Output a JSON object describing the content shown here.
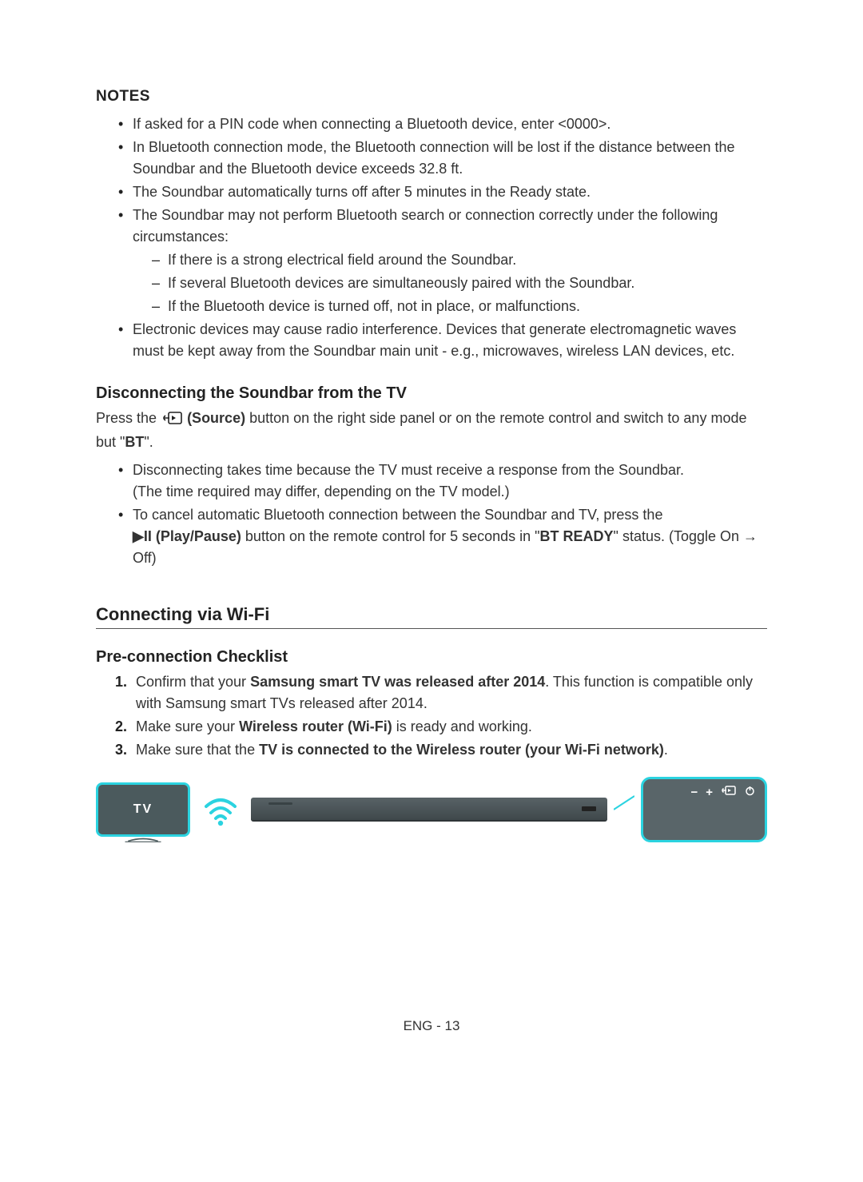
{
  "notes": {
    "heading": "NOTES",
    "items": [
      "If asked for a PIN code when connecting a Bluetooth device, enter <0000>.",
      "In Bluetooth connection mode, the Bluetooth connection will be lost if the distance between the Soundbar and the Bluetooth device exceeds 32.8 ft.",
      "The Soundbar automatically turns off after 5 minutes in the Ready state.",
      "The Soundbar may not perform Bluetooth search or connection correctly under the following circumstances:",
      "Electronic devices may cause radio interference. Devices that generate electromagnetic waves must be kept away from the Soundbar main unit - e.g., microwaves, wireless LAN devices, etc."
    ],
    "sub_items": [
      "If there is a strong electrical field around the Soundbar.",
      "If several Bluetooth devices are simultaneously paired with the Soundbar.",
      "If the Bluetooth device is turned off, not in place, or malfunctions."
    ]
  },
  "disconnect": {
    "heading": "Disconnecting the Soundbar from the TV",
    "para_prefix": "Press the ",
    "source_label": " (Source)",
    "para_mid": " button on the right side panel or on the remote control and switch to any mode but \"",
    "bt_label": "BT",
    "para_suffix": "\".",
    "bullets": {
      "b1_line1": "Disconnecting takes time because the TV must receive a response from the Soundbar.",
      "b1_line2": "(The time required may differ, depending on the TV model.)",
      "b2_line1": "To cancel automatic Bluetooth connection between the Soundbar and TV, press the ",
      "b2_play": "▶II (Play/Pause)",
      "b2_mid": " button on the remote control for 5 seconds in \"",
      "b2_btready": "BT READY",
      "b2_suffix": "\" status. (Toggle On → Off)"
    }
  },
  "wifi": {
    "heading": "Connecting via Wi-Fi",
    "checklist_heading": "Pre-connection Checklist",
    "items": {
      "i1_prefix": "Confirm that your ",
      "i1_bold": "Samsung smart TV was released after 2014",
      "i1_suffix": ". This function is compatible only with Samsung smart TVs released after 2014.",
      "i2_prefix": "Make sure your ",
      "i2_bold": "Wireless router (Wi-Fi)",
      "i2_suffix": " is ready and working.",
      "i3_prefix": "Make sure that the ",
      "i3_bold": "TV is connected to the Wireless router (your Wi-Fi network)",
      "i3_suffix": "."
    }
  },
  "diagram": {
    "tv_label": "TV",
    "cp_minus": "−",
    "cp_plus": "+"
  },
  "footer": "ENG - 13"
}
